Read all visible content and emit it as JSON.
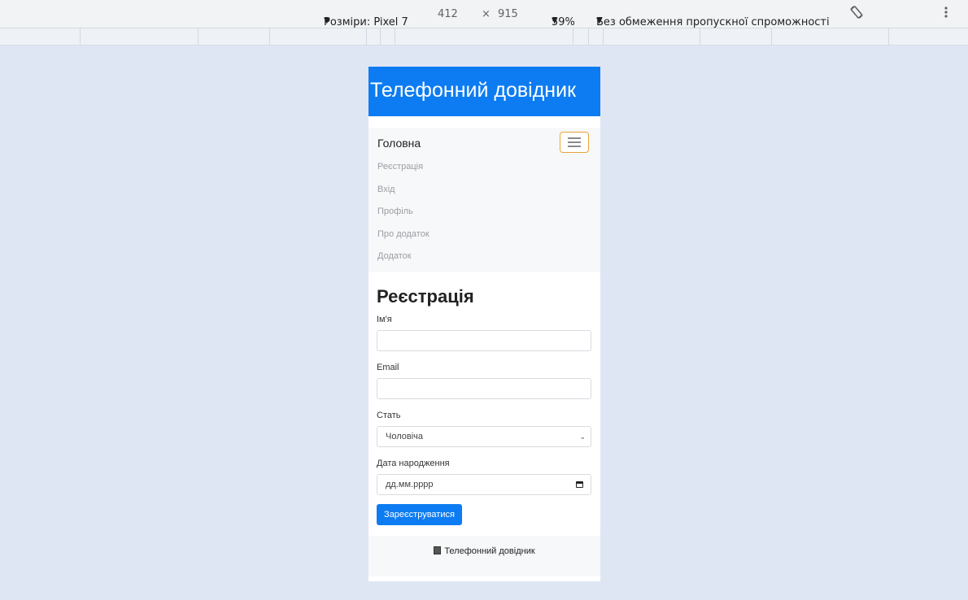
{
  "devtools": {
    "device_label": "Розміри: Pixel 7",
    "width": "412",
    "times": "×",
    "height": "915",
    "zoom": "59%",
    "throttling": "Без обмеження пропускної спроможності",
    "caret": "▼",
    "rotate_icon": "rotate-icon",
    "more_icon": "more-vert-icon"
  },
  "site": {
    "banner_title": "Телефонний довідник",
    "nav": {
      "brand": "Головна",
      "toggler_icon": "hamburger-icon",
      "links": [
        "Реєстрація",
        "Вхід",
        "Профіль",
        "Про додаток",
        "Додаток"
      ]
    },
    "form": {
      "title": "Реєстрація",
      "name_label": "Ім'я",
      "name_value": "",
      "email_label": "Email",
      "email_value": "",
      "gender_label": "Стать",
      "gender_value": "Чоловіча",
      "birth_label": "Дата народження",
      "birth_placeholder": "дд.мм.рррр",
      "submit_label": "Зареєструватися"
    },
    "footer_text": "Телефонний довідник"
  },
  "colors": {
    "primary": "#0d7cf2",
    "toggler_border": "#e8a33a",
    "page_bg": "#dfe6f3"
  }
}
